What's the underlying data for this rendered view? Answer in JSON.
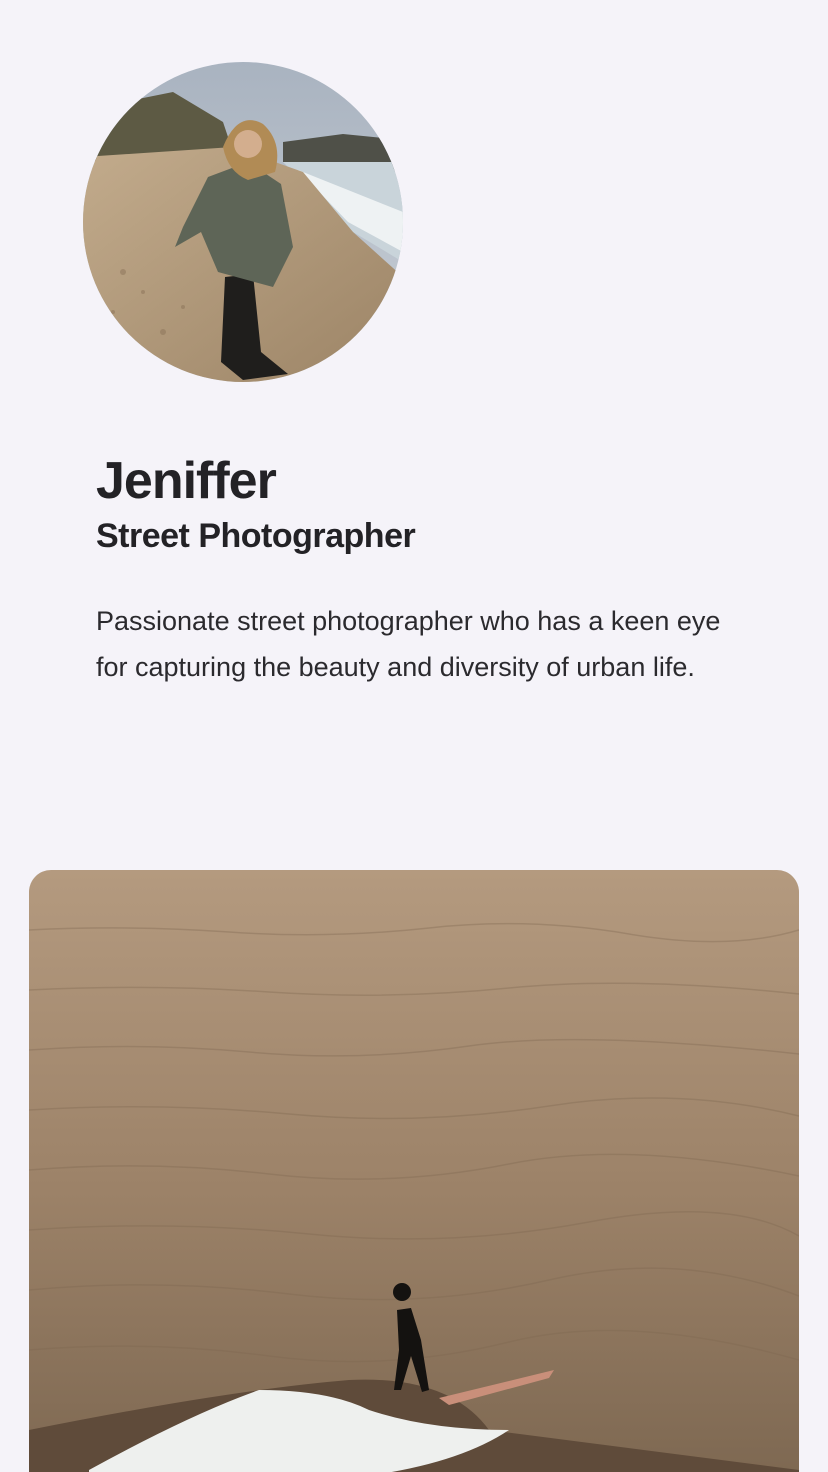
{
  "profile": {
    "name": "Jeniffer",
    "title": "Street Photographer",
    "bio": "Passionate street photographer who has a keen eye for capturing the beauty and diversity of urban life.",
    "avatar_image": "woman-on-beach-photo",
    "gallery_image": "surfer-at-sunset-photo"
  },
  "colors": {
    "background": "#f5f3f9",
    "text": "#232226"
  }
}
